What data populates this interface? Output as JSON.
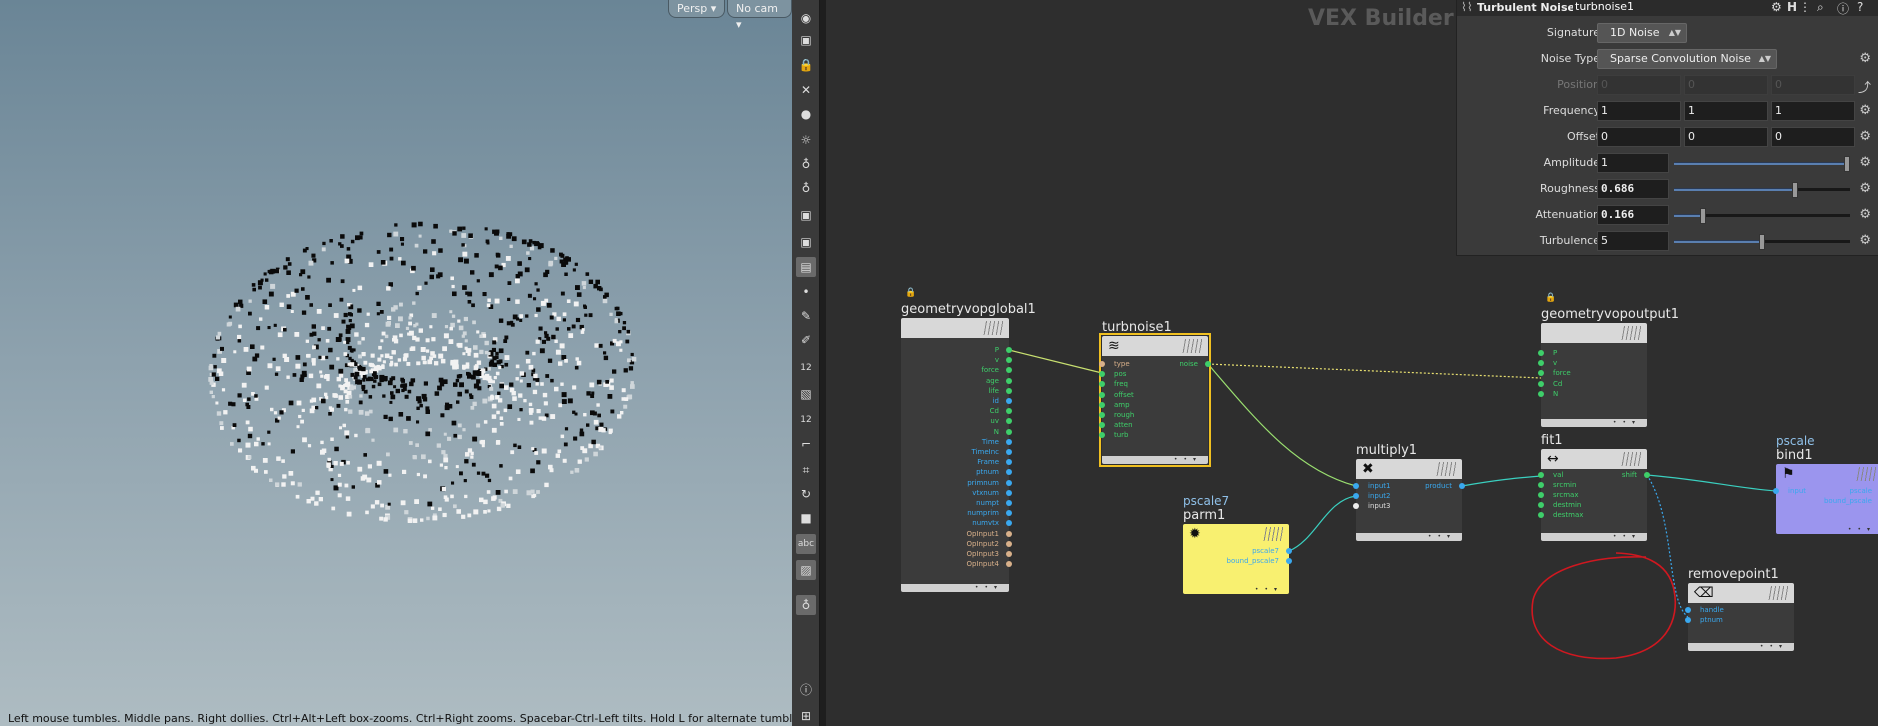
{
  "viewport": {
    "persp_label": "Persp",
    "cam_label": "No cam",
    "status_text": "Left mouse tumbles. Middle pans. Right dollies. Ctrl+Alt+Left box-zooms. Ctrl+Right zooms. Spacebar-Ctrl-Left tilts. Hold L for alternate tumble, dolly, and"
  },
  "toolbar": {
    "icons": [
      "eye-icon",
      "camera-icon",
      "lock-icon",
      "x-icon",
      "sphere-icon",
      "light-icon",
      "bulb-icon",
      "bulb-plus-icon",
      "camera-view-icon",
      "camera-icon",
      "render-icon",
      "dot-icon",
      "pencil-icon",
      "brush-icon",
      "number-12-icon",
      "select-icon",
      "number-12-icon",
      "corner-icon",
      "snap-icon",
      "rotate-icon",
      "stop-icon",
      "text-icon",
      "image-icon",
      "bulb-icon",
      "info-icon",
      "grid-icon"
    ],
    "label_12": "12",
    "label_abc": "abc"
  },
  "network": {
    "title": "VEX Builder",
    "nodes": {
      "global": {
        "name": "geometryvopglobal1",
        "outputs": [
          "P",
          "v",
          "force",
          "age",
          "life",
          "id",
          "Cd",
          "uv",
          "N",
          "Time",
          "TimeInc",
          "Frame",
          "ptnum",
          "primnum",
          "vtxnum",
          "numpt",
          "numprim",
          "numvtx",
          "OpInput1",
          "OpInput2",
          "OpInput3",
          "OpInput4"
        ]
      },
      "turbnoise": {
        "name": "turbnoise1",
        "inputs": [
          "type",
          "pos",
          "freq",
          "offset",
          "amp",
          "rough",
          "atten",
          "turb"
        ],
        "output": "noise"
      },
      "output": {
        "name": "geometryvopoutput1",
        "inputs": [
          "P",
          "v",
          "force",
          "Cd",
          "N"
        ]
      },
      "multiply": {
        "name": "multiply1",
        "inputs": [
          "input1",
          "input2",
          "input3"
        ],
        "output": "product"
      },
      "parm": {
        "label": "pscale7",
        "name": "parm1",
        "outputs": [
          "pscale7",
          "bound_pscale7"
        ]
      },
      "fit": {
        "name": "fit1",
        "inputs": [
          "val",
          "srcmin",
          "srcmax",
          "destmin",
          "destmax"
        ],
        "output": "shift"
      },
      "bind": {
        "label": "pscale",
        "name": "bind1",
        "input": "input",
        "outputs": [
          "pscale",
          "bound_pscale"
        ]
      },
      "removepoint": {
        "name": "removepoint1",
        "inputs": [
          "handle",
          "ptnum"
        ]
      }
    }
  },
  "params": {
    "node_type": "Turbulent Noise",
    "node_name": "turbnoise1",
    "signature_label": "Signature",
    "signature_value": "1D Noise",
    "noise_type_label": "Noise Type",
    "noise_type_value": "Sparse Convolution Noise",
    "position_label": "Position",
    "position": [
      "0",
      "0",
      "0"
    ],
    "frequency_label": "Frequency",
    "frequency": [
      "1",
      "1",
      "1"
    ],
    "offset_label": "Offset",
    "offset": [
      "0",
      "0",
      "0"
    ],
    "amplitude_label": "Amplitude",
    "amplitude": "1",
    "amplitude_fill": 1.0,
    "roughness_label": "Roughness",
    "roughness": "0.686",
    "roughness_fill": 0.686,
    "attenuation_label": "Attenuation",
    "attenuation": "0.166",
    "attenuation_fill": 0.166,
    "turbulence_label": "Turbulence",
    "turbulence": "5",
    "turbulence_fill": 0.5
  },
  "colors": {
    "port_green": "#3ecf6a",
    "port_blue": "#3aa8ee",
    "port_tan": "#d8b08a",
    "selected_outline": "#f0c020",
    "parm_node": "#f8f070",
    "bind_node": "#9b95ee",
    "annotation_red": "#d01820"
  }
}
